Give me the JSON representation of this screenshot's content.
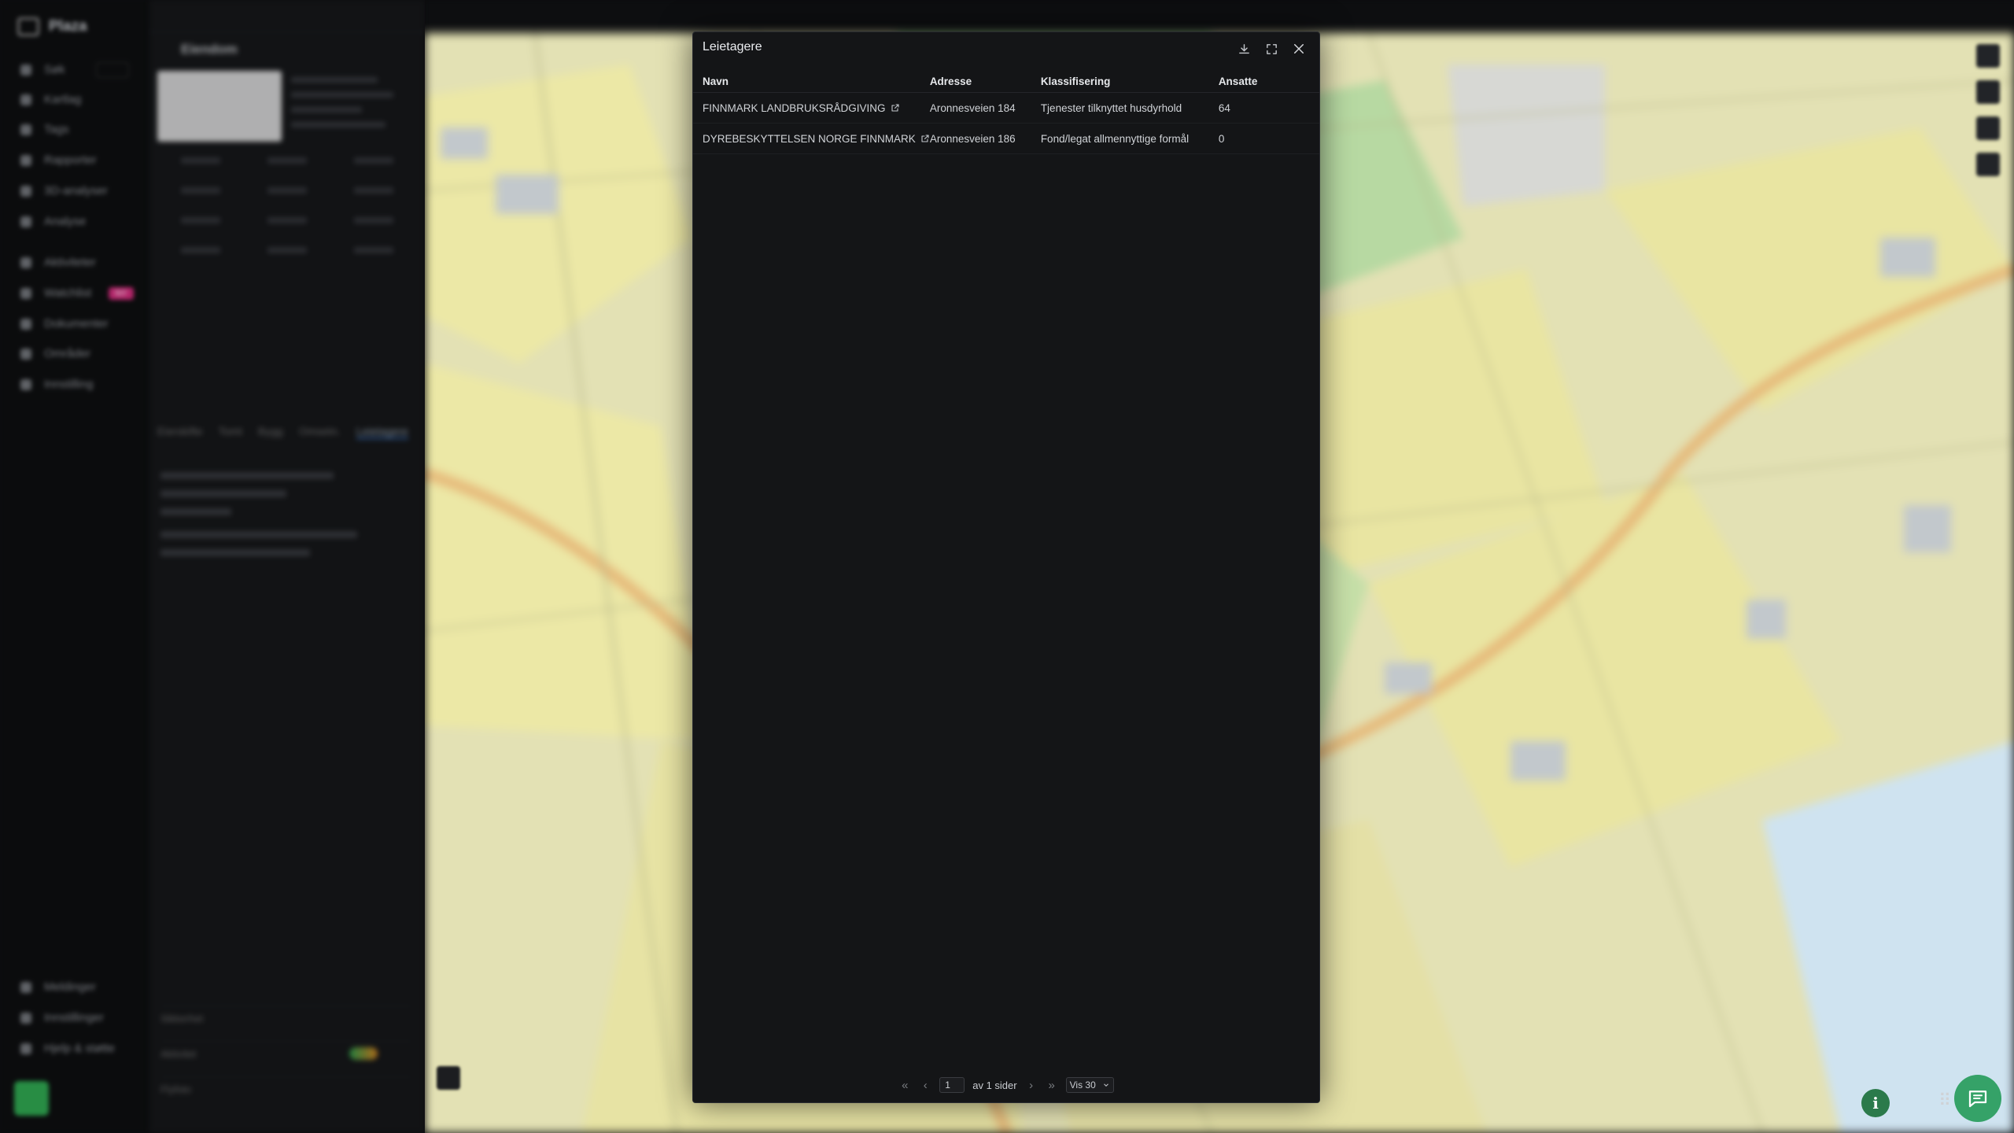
{
  "nav": {
    "brand": "Plaza",
    "items": [
      "Søk",
      "Kartlag",
      "Tags",
      "Rapporter",
      "3D-analyser",
      "Analyse",
      "Aktiviteter",
      "Watchlist",
      "Dokumenter",
      "Områder",
      "Innstilling"
    ],
    "watchlist_badge": "NY",
    "bottom_items": [
      "Meldinger",
      "Innstillinger",
      "Hjelp & støtte"
    ]
  },
  "panel": {
    "title": "Eiendom",
    "tabs": [
      "Eierskifte",
      "Tomt",
      "Bygg",
      "Omsetn.",
      "Leietagere"
    ],
    "footer_items": [
      "Sikkerhet",
      "Aktivitet",
      "Flyfoto"
    ]
  },
  "modal": {
    "title": "Leietagere",
    "icons": {
      "download": "download-icon",
      "expand": "expand-icon",
      "close": "close-icon"
    },
    "columns": [
      "Navn",
      "Adresse",
      "Klassifisering",
      "Ansatte"
    ],
    "rows": [
      {
        "name": "FINNMARK LANDBRUKSRÅDGIVING",
        "address": "Aronnesveien 184",
        "classification": "Tjenester tilknyttet husdyrhold",
        "employees": "64"
      },
      {
        "name": "DYREBESKYTTELSEN NORGE FINNMARK",
        "address": "Aronnesveien 186",
        "classification": "Fond/legat allmennyttige formål",
        "employees": "0"
      }
    ],
    "pagination": {
      "current_page": "1",
      "of_pages_label": "av 1 sider",
      "page_size_label": "Vis 30"
    }
  },
  "colors": {
    "modal_bg": "#141517",
    "map_field_yellow": "#e7e3a4",
    "map_forest_green": "#99cc8a",
    "map_road": "#e6b878",
    "chat_button": "#35a268"
  }
}
